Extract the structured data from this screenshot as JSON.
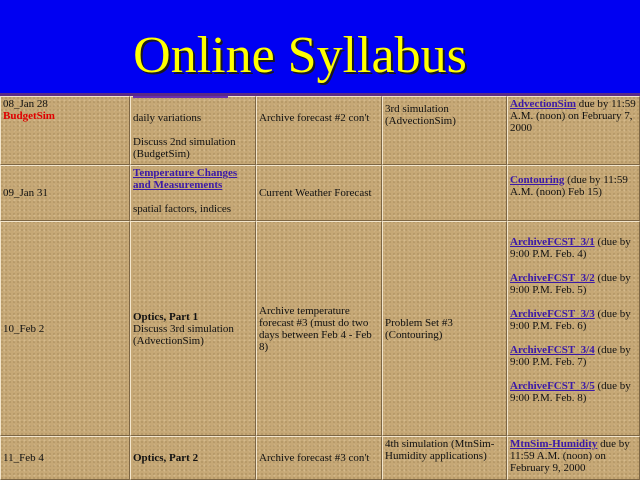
{
  "header": {
    "title": "Online Syllabus",
    "bg_color": "#0000f2",
    "title_color": "#ffff00"
  },
  "rows": [
    {
      "class": "08_Jan 28",
      "class_sub": "BudgetSim",
      "topic_line1": "daily variations",
      "topic_line2": "Discuss 2nd simulation (BudgetSim)",
      "forecast": "Archive forecast #2 con't",
      "assignment": "3rd simulation (AdvectionSim)",
      "due_link": "AdvectionSim",
      "due_text": " due by 11:59 A.M. (noon) on February 7, 2000"
    },
    {
      "class": "09_Jan 31",
      "topic_link": "Temperature Changes and Measurements",
      "topic_text": "spatial factors, indices",
      "forecast": "Current Weather Forecast",
      "assignment": "",
      "due_link": "Contouring",
      "due_text": " (due by 11:59 A.M. (noon) Feb 15)"
    },
    {
      "class": "10_Feb 2",
      "topic_bold": "Optics, Part 1",
      "topic_text": "Discuss 3rd simulation (AdvectionSim)",
      "forecast": "Archive temperature forecast #3 (must do two days between Feb 4 - Feb 8)",
      "assignment": "Problem Set #3 (Contouring)",
      "due_items": [
        {
          "link": "ArchiveFCST_3/1",
          "text": " (due by 9:00 P.M. Feb. 4)"
        },
        {
          "link": "ArchiveFCST_3/2",
          "text": " (due by 9:00 P.M. Feb. 5)"
        },
        {
          "link": "ArchiveFCST_3/3",
          "text": " (due by 9:00 P.M. Feb. 6)"
        },
        {
          "link": "ArchiveFCST_3/4",
          "text": " (due by 9:00 P.M. Feb. 7)"
        },
        {
          "link": "ArchiveFCST_3/5",
          "text": " (due by 9:00 P.M. Feb. 8)"
        }
      ]
    },
    {
      "class": "11_Feb 4",
      "topic_bold": "Optics, Part 2",
      "forecast": "Archive forecast #3 con't",
      "assignment": "4th simulation (MtnSim-Humidity applications)",
      "due_link": "MtnSim-Humidity",
      "due_text": " due by 11:59 A.M. (noon) on February 9, 2000"
    }
  ]
}
